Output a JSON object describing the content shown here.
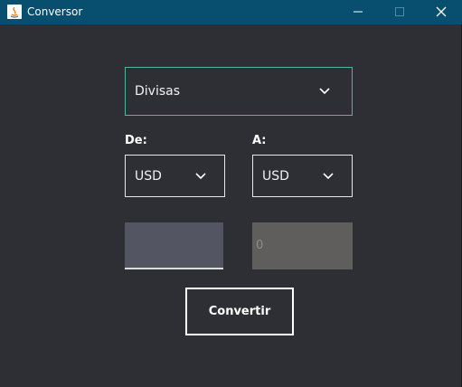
{
  "window": {
    "title": "Conversor",
    "controls": {
      "minimize_icon": "minimize-icon",
      "maximize_icon": "maximize-icon",
      "close_icon": "close-icon"
    }
  },
  "form": {
    "category": {
      "selected": "Divisas",
      "icon": "chevron-down-icon"
    },
    "from": {
      "label": "De:",
      "selected": "USD",
      "icon": "chevron-down-icon"
    },
    "to": {
      "label": "A:",
      "selected": "USD",
      "icon": "chevron-down-icon"
    },
    "amount": {
      "value": "",
      "placeholder": ""
    },
    "result": {
      "value": "0"
    },
    "convert_label": "Convertir"
  },
  "colors": {
    "titlebar": "#084e6e",
    "background": "#2e2f35",
    "accent_border": "#4fb3a6",
    "input_bg": "#535662",
    "result_bg": "#605e5c",
    "text": "#ffffff"
  }
}
